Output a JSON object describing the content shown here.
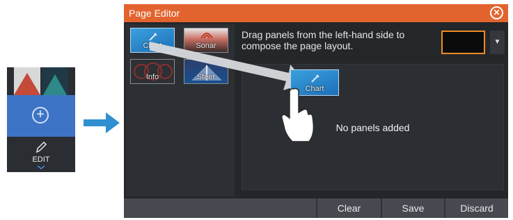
{
  "sidebar": {
    "add_symbol": "+",
    "edit_label": "EDIT"
  },
  "dialog": {
    "title": "Page Editor",
    "instructions": "Drag panels from the left-hand side to compose the page layout.",
    "empty_message": "No panels added",
    "panels": [
      {
        "label": "Chart",
        "icon": "chart-icon"
      },
      {
        "label": "Sonar",
        "icon": "sonar-icon"
      },
      {
        "label": "Info",
        "icon": "info-gauges-icon"
      },
      {
        "label": "Steer",
        "icon": "steer-icon"
      }
    ],
    "dragged_panel": {
      "label": "Chart"
    },
    "buttons": {
      "clear": "Clear",
      "save": "Save",
      "discard": "Discard"
    }
  },
  "colors": {
    "titlebar": "#e2632d",
    "accent_blue": "#3e74c5",
    "layout_highlight": "#f08a24",
    "dialog_bg": "#24272a"
  }
}
